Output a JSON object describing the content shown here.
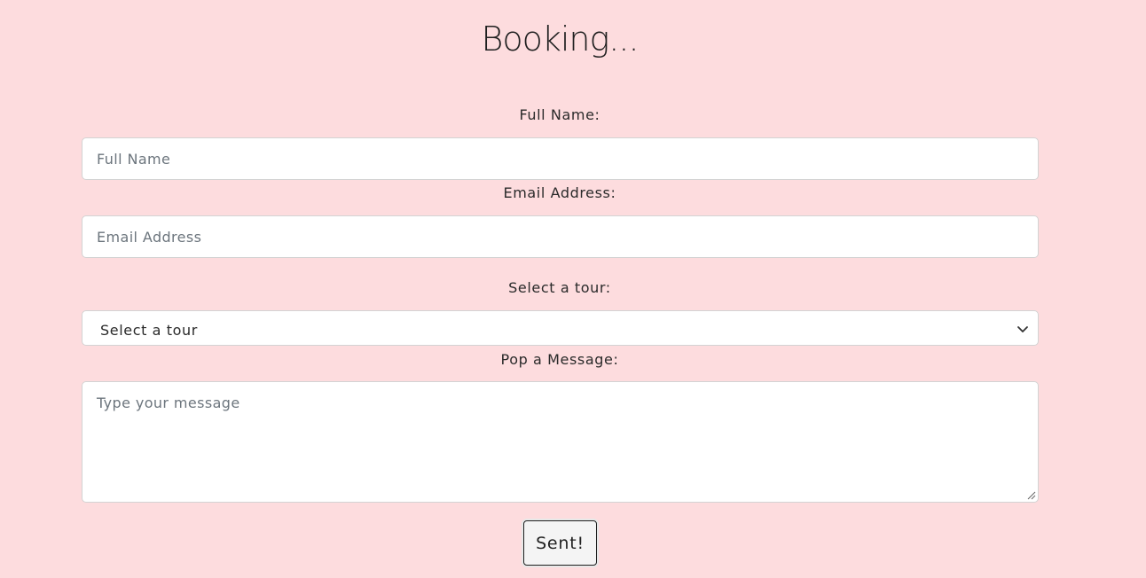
{
  "page_title": "Booking...",
  "form": {
    "full_name": {
      "label": "Full Name:",
      "placeholder": "Full Name",
      "value": ""
    },
    "email": {
      "label": "Email Address:",
      "placeholder": "Email Address",
      "value": ""
    },
    "tour": {
      "label": "Select a tour:",
      "selected": "Select a tour"
    },
    "message": {
      "label": "Pop a Message:",
      "placeholder": "Type your message",
      "value": ""
    },
    "submit_label": "Sent!"
  },
  "icons": {
    "select_arrow": "chevron-down-icon",
    "textarea_resize": "resize-grip-icon"
  },
  "colors": {
    "background": "#fddcde",
    "field_background": "#ffffff",
    "field_border": "#d3d3d3",
    "button_background": "#f4f4f4"
  }
}
